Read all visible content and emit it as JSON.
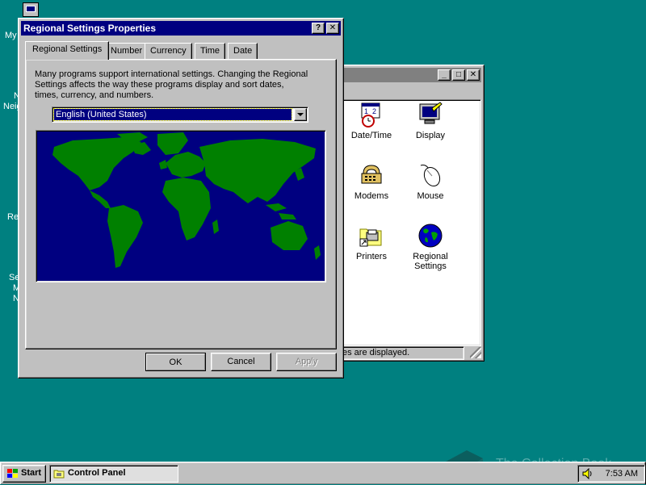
{
  "desktop": {
    "icon_labels_partial": [
      "My",
      "N",
      "Neig",
      "Re",
      "Se",
      "M",
      "N"
    ]
  },
  "dialog": {
    "title": "Regional Settings Properties",
    "help_button": "?",
    "close_button": "✕",
    "tabs": [
      {
        "label": "Regional Settings",
        "active": true
      },
      {
        "label": "Number",
        "active": false
      },
      {
        "label": "Currency",
        "active": false
      },
      {
        "label": "Time",
        "active": false
      },
      {
        "label": "Date",
        "active": false
      }
    ],
    "description": "Many programs support international settings. Changing the Regional Settings affects the way these programs display and sort dates, times, currency, and numbers.",
    "locale_select": {
      "value": "English (United States)"
    },
    "buttons": {
      "ok": "OK",
      "cancel": "Cancel",
      "apply": "Apply"
    }
  },
  "control_panel": {
    "items": [
      {
        "label": "Date/Time",
        "icon": "calendar-clock-icon"
      },
      {
        "label": "Display",
        "icon": "monitor-icon"
      },
      {
        "label": "Modems",
        "icon": "modem-phone-icon"
      },
      {
        "label": "Mouse",
        "icon": "mouse-icon"
      },
      {
        "label": "Printers",
        "icon": "printer-folder-icon"
      },
      {
        "label": "Regional Settings",
        "icon": "globe-icon"
      }
    ],
    "status_text": "es are displayed."
  },
  "taskbar": {
    "start_label": "Start",
    "tasks": [
      {
        "label": "Control Panel",
        "icon": "folder-icon"
      }
    ],
    "clock": "7:53 AM",
    "tray_icon": "speaker-icon"
  },
  "watermark": "The Collection Book",
  "colors": {
    "desktop": "#008080",
    "titlebar_active": "#000080",
    "titlebar_inactive": "#808080",
    "face": "#c0c0c0",
    "map_ocean": "#000080",
    "map_land": "#008000"
  }
}
